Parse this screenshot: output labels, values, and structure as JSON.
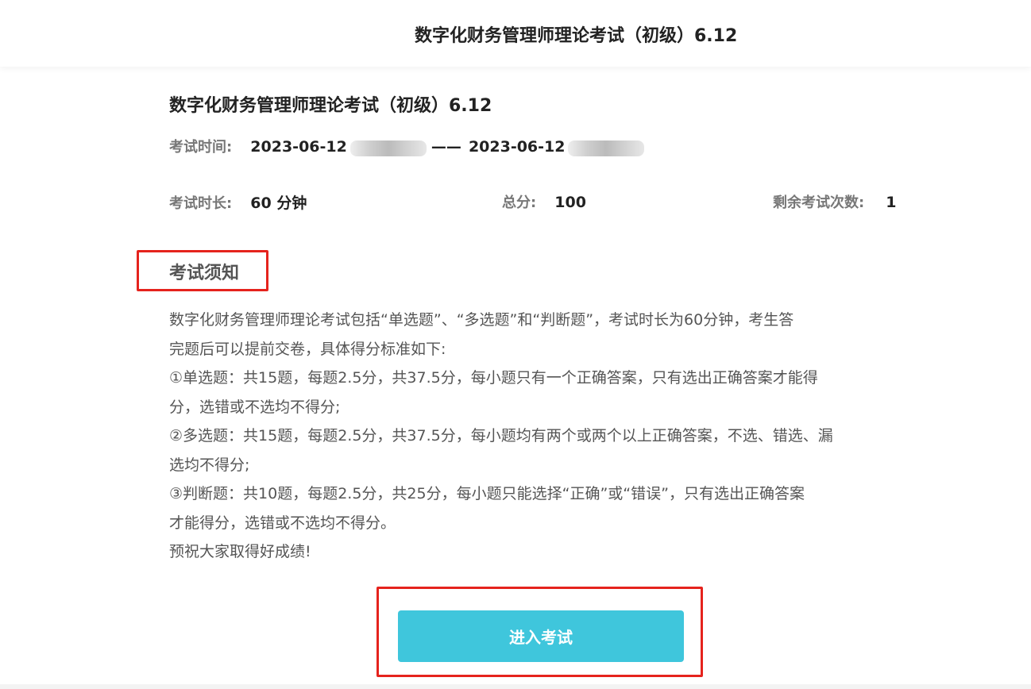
{
  "header": {
    "title": "数字化财务管理师理论考试（初级）6.12"
  },
  "exam": {
    "title": "数字化财务管理师理论考试（初级）6.12",
    "time_label": "考试时间:",
    "start_date": "2023-06-12",
    "separator": "——",
    "end_date": "2023-06-12",
    "duration_label": "考试时长:",
    "duration_value": "60 分钟",
    "score_label": "总分:",
    "score_value": "100",
    "remaining_label": "剩余考试次数:",
    "remaining_value": "1"
  },
  "notice": {
    "heading": "考试须知",
    "lines": [
      "数字化财务管理师理论考试包括“单选题”、“多选题”和“判断题”，考试时长为60分钟，考生答",
      "完题后可以提前交卷，具体得分标准如下:",
      "①单选题：共15题，每题2.5分，共37.5分，每小题只有一个正确答案，只有选出正确答案才能得",
      "分，选错或不选均不得分;",
      "②多选题：共15题，每题2.5分，共37.5分，每小题均有两个或两个以上正确答案，不选、错选、漏",
      "选均不得分;",
      "③判断题：共10题，每题2.5分，共25分，每小题只能选择“正确”或“错误”，只有选出正确答案",
      "才能得分，选错或不选均不得分。",
      "预祝大家取得好成绩!"
    ]
  },
  "actions": {
    "enter_label": "进入考试"
  },
  "colors": {
    "accent": "#3fc6dc",
    "highlight": "#e5231d"
  }
}
